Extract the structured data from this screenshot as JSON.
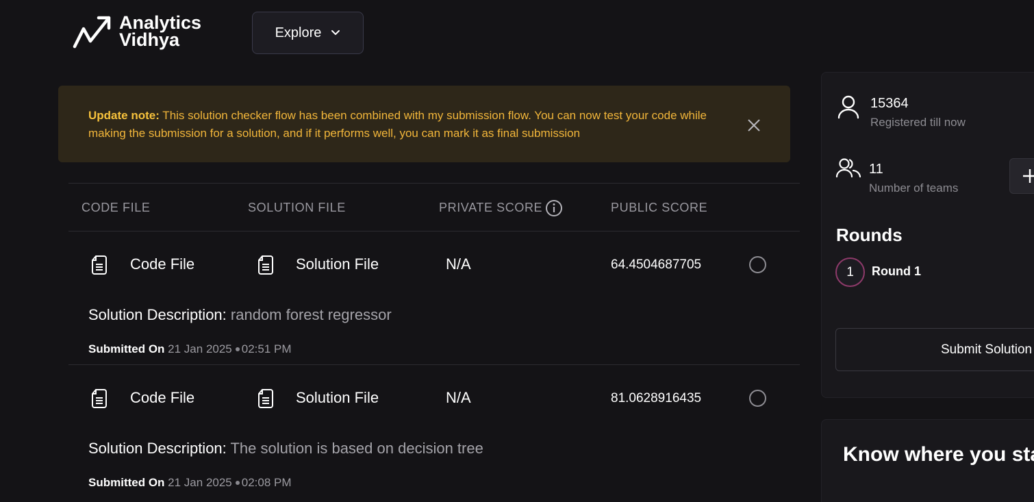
{
  "header": {
    "logo_line1": "Analytics",
    "logo_line2": "Vidhya",
    "explore_label": "Explore"
  },
  "note": {
    "label": "Update note:",
    "text": " This solution checker flow has been combined with my submission flow. You can now test your code while making the submission for a solution, and if it performs well, you can mark it as final submission"
  },
  "table": {
    "columns": [
      "CODE FILE",
      "SOLUTION FILE",
      "PRIVATE SCORE",
      "PUBLIC SCORE"
    ],
    "rows": [
      {
        "code_file": "Code File",
        "solution_file": "Solution File",
        "private_score": "N/A",
        "public_score": "64.4504687705",
        "desc_label": "Solution Description:",
        "desc_value": " random forest regressor",
        "submitted_label": "Submitted On",
        "date": " 21 Jan 2025",
        "time": "02:51 PM"
      },
      {
        "code_file": "Code File",
        "solution_file": "Solution File",
        "private_score": "N/A",
        "public_score": "81.0628916435",
        "desc_label": "Solution Description:",
        "desc_value": " The solution is based on decision tree",
        "submitted_label": "Submitted On",
        "date": " 21 Jan 2025",
        "time": "02:08 PM"
      }
    ]
  },
  "sidebar": {
    "registered_count": "15364",
    "registered_label": "Registered till now",
    "teams_count": "11",
    "teams_label": "Number of teams",
    "rounds_title": "Rounds",
    "round_number": "1",
    "round_label": "Round 1",
    "submit_label": "Submit Solution"
  },
  "know": {
    "title": "Know where you stand"
  },
  "colors": {
    "background": "#141316",
    "note_bg": "#2e2719",
    "note_text": "#f2b63a",
    "panel_bg": "#19181c"
  }
}
